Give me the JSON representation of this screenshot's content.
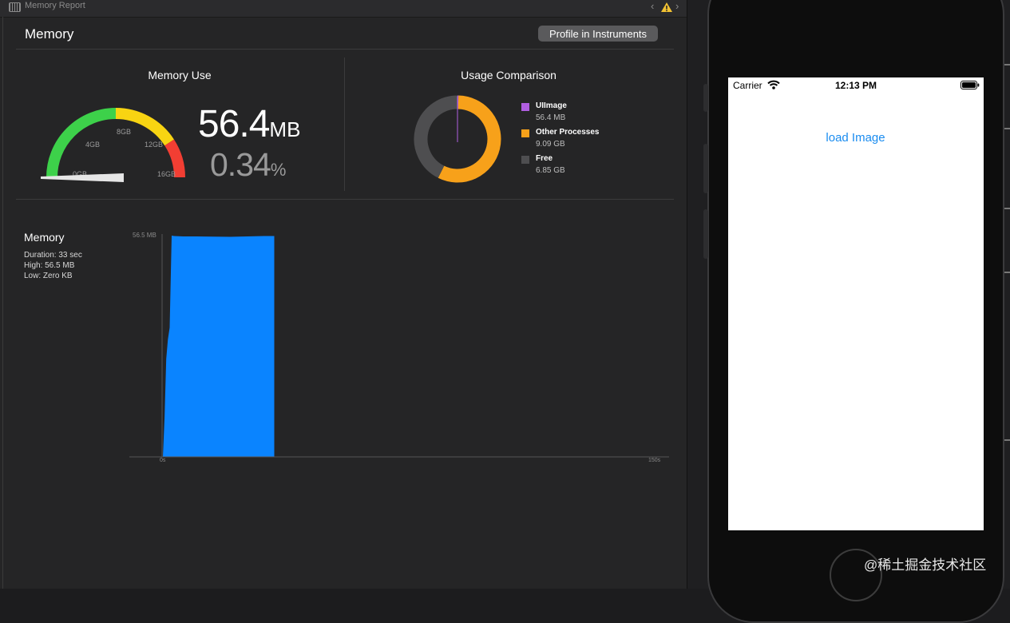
{
  "window": {
    "title": "Memory Report",
    "nav_back": "‹",
    "nav_forward": "›"
  },
  "panel": {
    "title": "Memory",
    "profile_button": "Profile in Instruments"
  },
  "memory_use": {
    "title": "Memory Use",
    "gauge_labels": [
      "0GB",
      "4GB",
      "8GB",
      "12GB",
      "16GB"
    ],
    "gauge_fraction": 0.0034,
    "value": "56.4",
    "value_unit": "MB",
    "percent": "0.34",
    "percent_unit": "%",
    "colors": {
      "green": "#3dd14a",
      "yellow": "#f8d412",
      "red": "#f23e33"
    }
  },
  "usage_comparison": {
    "title": "Usage Comparison",
    "legend": [
      {
        "name": "UIImage",
        "value": "56.4 MB",
        "color": "#b05ee0",
        "share": 0.0035
      },
      {
        "name": "Other Processes",
        "value": "9.09 GB",
        "color": "#f7a11a",
        "share": 0.57
      },
      {
        "name": "Free",
        "value": "6.85 GB",
        "color": "#4e4e50",
        "share": 0.4265
      }
    ]
  },
  "graph": {
    "title": "Memory",
    "duration": "Duration: 33 sec",
    "high": "High: 56.5 MB",
    "low": "Low: Zero KB",
    "y_max_label": "56.5 MB",
    "x_start_label": "0s",
    "x_end_label": "150s",
    "bar_color": "#0a84ff"
  },
  "chart_data": {
    "type": "area",
    "title": "Memory",
    "xlabel": "",
    "ylabel": "",
    "xlim": [
      0,
      150
    ],
    "ylim": [
      0,
      56.5
    ],
    "x": [
      0,
      0.5,
      1,
      1.5,
      2,
      2.6,
      3.3,
      6,
      10,
      20,
      30,
      33,
      33.01
    ],
    "series": [
      {
        "values": [
          0,
          10,
          25,
          30,
          33,
          56.5,
          56.4,
          56.3,
          56.3,
          56.2,
          56.4,
          56.4,
          0
        ]
      }
    ]
  },
  "simulator": {
    "carrier": "Carrier",
    "time": "12:13 PM",
    "button_label": "load Image"
  },
  "watermark": "@稀土掘金技术社区"
}
